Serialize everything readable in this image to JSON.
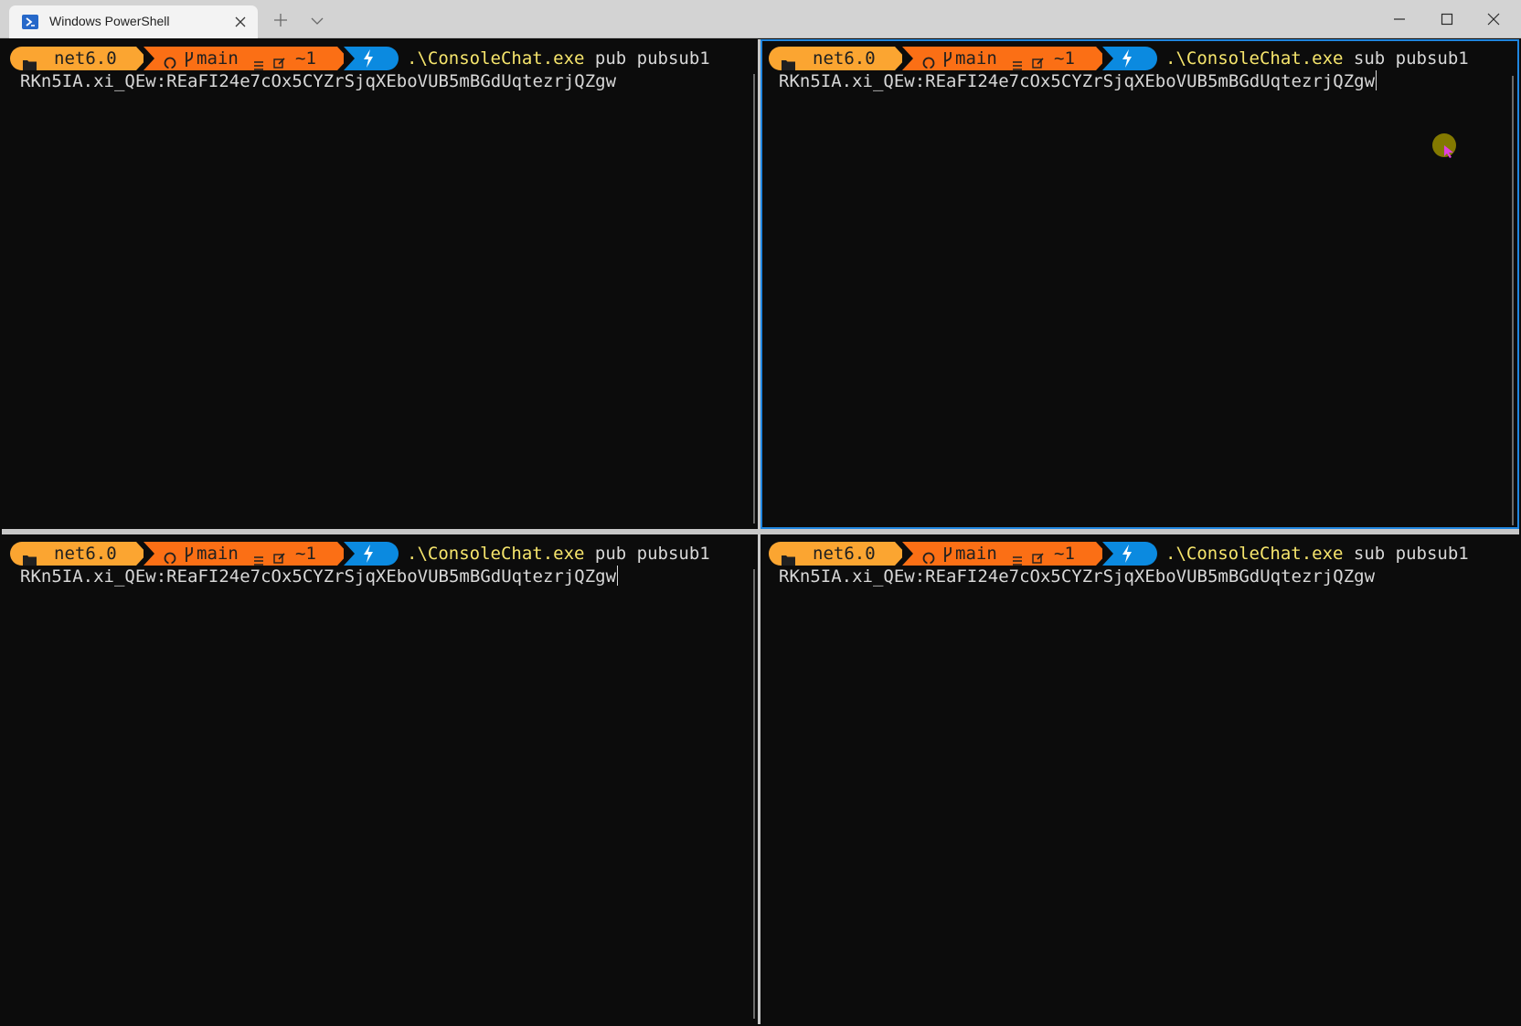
{
  "window": {
    "tab_title": "Windows PowerShell",
    "icons": [
      "powershell-icon",
      "close-icon",
      "plus-icon",
      "chevron-down-icon",
      "minimize-icon",
      "maximize-icon",
      "close-icon"
    ]
  },
  "theme": {
    "folder_segment": "#fba531",
    "git_segment": "#fb6f15",
    "power_segment": "#0b8ae0",
    "command_color": "#f6e56c",
    "text_color": "#d8d8d8",
    "active_border": "#1f86e0"
  },
  "panes": [
    {
      "folder": "net6.0",
      "branch": "main",
      "status": "≡",
      "changes": "~1",
      "command": ".\\ConsoleChat.exe",
      "args": "pub pubsub1",
      "output": "RKn5IA.xi_QEw:REaFI24e7cOx5CYZrSjqXEboVUB5mBGdUqtezrjQZgw"
    },
    {
      "folder": "net6.0",
      "branch": "main",
      "status": "≡",
      "changes": "~1",
      "command": ".\\ConsoleChat.exe",
      "args": "sub pubsub1",
      "output": "RKn5IA.xi_QEw:REaFI24e7cOx5CYZrSjqXEboVUB5mBGdUqtezrjQZgw"
    },
    {
      "folder": "net6.0",
      "branch": "main",
      "status": "≡",
      "changes": "~1",
      "command": ".\\ConsoleChat.exe",
      "args": "pub pubsub1",
      "output": "RKn5IA.xi_QEw:REaFI24e7cOx5CYZrSjqXEboVUB5mBGdUqtezrjQZgw"
    },
    {
      "folder": "net6.0",
      "branch": "main",
      "status": "≡",
      "changes": "~1",
      "command": ".\\ConsoleChat.exe",
      "args": "sub pubsub1",
      "output": "RKn5IA.xi_QEw:REaFI24e7cOx5CYZrSjqXEboVUB5mBGdUqtezrjQZgw"
    }
  ]
}
